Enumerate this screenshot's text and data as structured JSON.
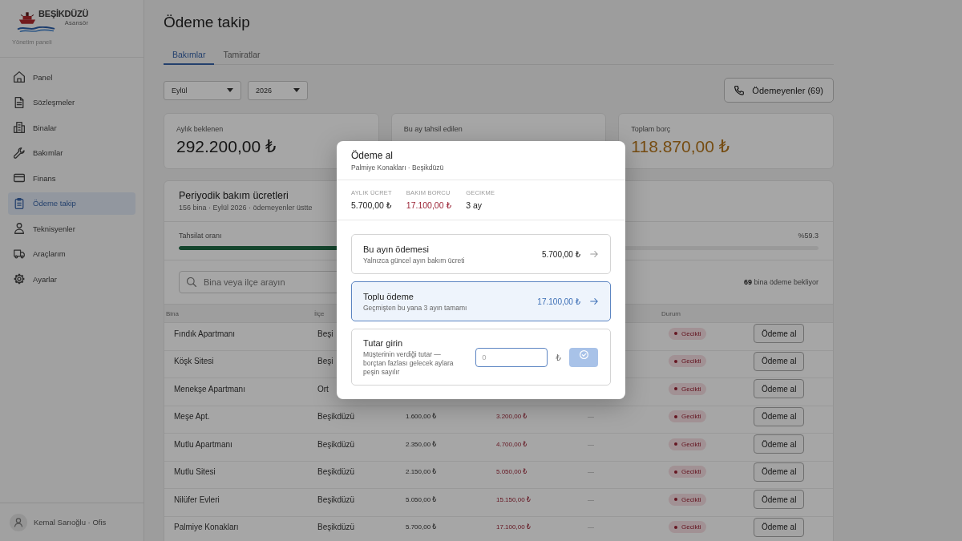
{
  "sidebar": {
    "logo": {
      "name": "BEŞİKDÜZÜ",
      "tagline": "Asansör"
    },
    "subtitle": "Yönetim paneli",
    "items": [
      {
        "label": "Panel",
        "selected": false
      },
      {
        "label": "Sözleşmeler",
        "selected": false
      },
      {
        "label": "Binalar",
        "selected": false
      },
      {
        "label": "Bakımlar",
        "selected": false
      },
      {
        "label": "Finans",
        "selected": false
      },
      {
        "label": "Ödeme takip",
        "selected": true
      },
      {
        "label": "Teknisyenler",
        "selected": false
      },
      {
        "label": "Araçlarım",
        "selected": false
      },
      {
        "label": "Ayarlar",
        "selected": false
      }
    ],
    "user": "Kemal Sarıoğlu · Ofis"
  },
  "page_title": "Ödeme takip",
  "tabs": [
    {
      "label": "Bakımlar",
      "selected": true
    },
    {
      "label": "Tamiratlar",
      "selected": false
    }
  ],
  "filters": [
    {
      "value": "Eylül"
    },
    {
      "value": "2026"
    }
  ],
  "unpaid_button": "Ödemeyenler (69)",
  "summary_cards": [
    {
      "label": "Aylık beklenen",
      "value": "292.200,00 ₺",
      "kind": "neutral"
    },
    {
      "label": "Bu ay tahsil edilen"
    },
    {
      "label": "Toplam borç",
      "value": "118.870,00 ₺",
      "kind": "warning"
    }
  ],
  "fees_panel": {
    "title": "Periyodik bakım ücretleri",
    "subtitle": "156 bina · Eylül 2026 · ödemeyenler üstte",
    "collection": {
      "label": "Tahsilat oranı",
      "level": 0.593,
      "reading": "%59.3"
    },
    "search": {
      "placeholder": "Bina veya ilçe arayın"
    },
    "pending": "**69** bina ödeme bekliyor",
    "table": {
      "header": {
        "building": "Bina",
        "district": "İlçe",
        "status": "Durum"
      },
      "rows": [
        {
          "building": "Fındık Apartmanı",
          "district": "Beşi",
          "status": "Gecikti",
          "action": "Ödeme al"
        },
        {
          "building": "Köşk Sitesi",
          "district": "Beşi",
          "status": "Gecikti",
          "action": "Ödeme al"
        },
        {
          "building": "Menekşe Apartmanı",
          "district": "Ort",
          "status": "Gecikti",
          "action": "Ödeme al"
        },
        {
          "building": "Meşe Apt.",
          "district": "Beşikdüzü",
          "column_3": "1.600,00 ₺",
          "column_4": "3.200,00 ₺",
          "column_5": "—",
          "status": "Gecikti",
          "action": "Ödeme al"
        },
        {
          "building": "Mutlu Apartmanı",
          "district": "Beşikdüzü",
          "column_3": "2.350,00 ₺",
          "column_4": "4.700,00 ₺",
          "column_5": "—",
          "status": "Gecikti",
          "action": "Ödeme al"
        },
        {
          "building": "Mutlu Sitesi",
          "district": "Beşikdüzü",
          "column_3": "2.150,00 ₺",
          "column_4": "5.050,00 ₺",
          "column_5": "—",
          "status": "Gecikti",
          "action": "Ödeme al"
        },
        {
          "building": "Nilüfer Evleri",
          "district": "Beşikdüzü",
          "column_3": "5.050,00 ₺",
          "column_4": "15.150,00 ₺",
          "column_5": "—",
          "status": "Gecikti",
          "action": "Ödeme al"
        },
        {
          "building": "Palmiye Konakları",
          "district": "Beşikdüzü",
          "column_3": "5.700,00 ₺",
          "column_4": "17.100,00 ₺",
          "column_5": "—",
          "status": "Gecikti",
          "action": "Ödeme al"
        }
      ]
    }
  },
  "modal": {
    "title": "Ödeme al",
    "subtitle": "Palmiye Konakları · Beşikdüzü",
    "stats": [
      {
        "label": "AYLIK ÜCRET",
        "value": "5.700,00 ₺",
        "kind": "plain"
      },
      {
        "label": "BAKIM BORCU",
        "value": "17.100,00 ₺",
        "kind": "debt"
      },
      {
        "label": "GECIKME",
        "value": "3 ay",
        "kind": "plain"
      }
    ],
    "options": [
      {
        "kind": "preset",
        "title": "Bu ayın ödemesi",
        "description": "Yalnızca güncel ayın bakım ücreti",
        "amount": "5.700,00 ₺",
        "selected": false
      },
      {
        "kind": "preset",
        "title": "Toplu ödeme",
        "description": "Geçmişten bu yana 3 ayın tamamı",
        "amount": "17.100,00 ₺",
        "selected": true
      },
      {
        "kind": "custom",
        "title": "Tutar girin",
        "description": "Müşterinin verdiği tutar — borçtan fazlası gelecek aylara peşin sayılır",
        "input": {
          "placeholder": "0"
        },
        "currency": "₺",
        "confirm": {
          "disabled": true
        },
        "selected": false
      }
    ]
  }
}
